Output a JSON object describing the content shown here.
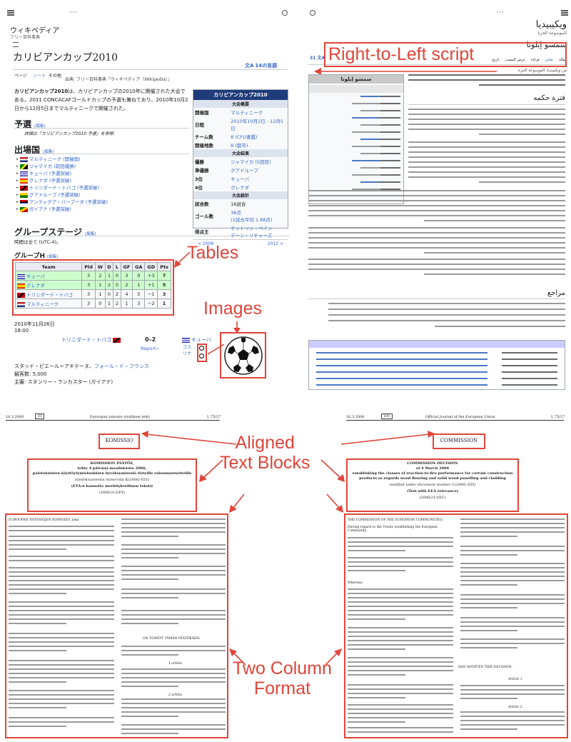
{
  "annotations": {
    "rtl": "Right-to-Left script",
    "tables": "Tables",
    "images": "Images",
    "aligned": "Aligned\nText Blocks",
    "twocol": "Two Column\nFormat"
  },
  "jp": {
    "site_name": "ウィキペディア",
    "site_tagline": "フリー百科事典",
    "title": "カリビアンカップ2010",
    "languages": "14の言語",
    "tab_page": "ページ",
    "tab_note": "ノート",
    "tab_other": "その他",
    "source": "出典: フリー百科事典『ウィキペディア（Wikipedia）』",
    "lead_bold": "カリビアンカップ2010",
    "lead": "は、カリビアンカップの2010年に開催された大会である。2011 CONCACAFゴールドカップの予選も兼ねており、2010年10月2日から12月5日までマルティニークで開催された。",
    "sec_prelim": "予選",
    "prelim_note": "詳細は「カリビアンカップ2010 予選」を参照",
    "sec_teams": "出場国",
    "teams": [
      "マルティニーク (開催国)",
      "ジャマイカ (前回優勝)",
      "キューバ (予選突破)",
      "グレナダ (予選突破)",
      "トリニダード・トバゴ (予選突破)",
      "グアドループ (予選突破)",
      "アンティグア・バーブーダ (予選突破)",
      "ガイアナ (予選突破)"
    ],
    "sec_group": "グループステージ",
    "tz_text": "時間は全て (UTC-4)。",
    "group_h": "グループH",
    "edit": "[編集]",
    "table_headers": [
      "Team",
      "Pld",
      "W",
      "D",
      "L",
      "GF",
      "GA",
      "GD",
      "Pts"
    ],
    "table_rows": [
      [
        "キューバ",
        "3",
        "2",
        "1",
        "0",
        "3",
        "0",
        "+3",
        "7"
      ],
      [
        "グレナダ",
        "3",
        "1",
        "2",
        "0",
        "2",
        "1",
        "+1",
        "5"
      ],
      [
        "トリニダード・トバゴ",
        "3",
        "1",
        "0",
        "2",
        "4",
        "5",
        "−1",
        "3"
      ],
      [
        "マルティニーク",
        "3",
        "0",
        "1",
        "2",
        "1",
        "3",
        "−2",
        "1"
      ]
    ],
    "match_date": "2010年11月26日",
    "match_time": "18:00",
    "match_home": "トリニダード・トバゴ",
    "match_score": "0–2",
    "match_away": "キューバ",
    "report": "Report",
    "scorer1": "コス",
    "scorer2": "リナ",
    "stadium_label": "スタッド・ピエール＝アキテーヌ、",
    "stadium_link": "フォール・ド・フランス",
    "attendance": "観客数: 5,000",
    "referee": "主審: スタンリー・ランカスター (ガイアナ)",
    "infobox": {
      "title": "カリビアンカップ2010",
      "sec1": "大会概要",
      "rows1": [
        [
          "開催国",
          "マルティニーク"
        ],
        [
          "日程",
          "2010年10月2日 - 12月5日"
        ],
        [
          "チーム数",
          "8 (CFU連盟)"
        ],
        [
          "開催地数",
          "8 (都市)"
        ]
      ],
      "sec2": "大会結果",
      "rows2": [
        [
          "優勝",
          "ジャマイカ (5回目)"
        ],
        [
          "準優勝",
          "グアドループ"
        ],
        [
          "3位",
          "キューバ"
        ],
        [
          "4位",
          "グレナダ"
        ]
      ],
      "sec3": "大会統計",
      "rows3": [
        [
          "試合数",
          "16試合"
        ],
        [
          "ゴール数",
          "36点\n(1試合平均 1.88点)"
        ],
        [
          "得点王",
          "ケットソン・ベイン\nデーン・リチャーズ"
        ]
      ],
      "prev": "< 2008",
      "next": "2012 >"
    }
  },
  "ar": {
    "site_name": "ويكيبيديا",
    "site_tagline": "الموسوعة الحرة",
    "title": "سمسو إيلونا",
    "tabs": [
      "مقالة",
      "نقاش",
      "قراءة",
      "عرض المصدر",
      "تاريخ"
    ],
    "source": "من ويكيبيديا، الموسوعة الحرة",
    "lang_count": "31",
    "infobox_title": "سمسو إيلونا",
    "sec_header": "فترة حكمه",
    "refs_header": "مراجع"
  },
  "fi": {
    "date": "16.3.2006",
    "page_label": "FI",
    "journal": "Euroopan unionin virallinen lehti",
    "page_ref": "L 75/27",
    "org": "KOMISSIO",
    "decision_label": "KOMISSION PÄÄTÖS,",
    "decision_date": "tehty 4 päivänä maaliskuuta 2006,",
    "decision_subject": "paloteknisten käyttäytymisluokkien hyväksymisestä tietyille rakennustuotteille",
    "notified": "(tiedoksiannettu numerolla K(2006) 655)",
    "eea": "(ETA:n kannalta merkityksellinen teksti)",
    "ref": "(2006/213/EY)",
    "col_lead": "EUROOPAN YHTEISÖJEN KOMISSIO, joka",
    "adopted": "ON TEHNYT TÄMÄN PÄÄTÖKSEN:",
    "article1": "1 artikla",
    "article2": "2 artikla"
  },
  "en": {
    "date": "16.3.2006",
    "page_label": "EN",
    "journal": "Official Journal of the European Union",
    "page_ref": "L 75/27",
    "org": "COMMISSION",
    "decision_label": "COMMISSION DECISION",
    "decision_date": "of 4 March 2006",
    "decision_subject": "establishing the classes of reaction-to-fire performance for certain construction products as regards wood flooring and solid wood panelling and cladding",
    "notified": "(notified under document number C(2006) 655)",
    "eea": "(Text with EEA relevance)",
    "ref": "(2006/213/EC)",
    "col_lead": "THE COMMISSION OF THE EUROPEAN COMMUNITIES,",
    "having_regard": "Having regard to the Treaty establishing the European Community,",
    "whereas": "Whereas:",
    "adopted": "HAS ADOPTED THIS DECISION:",
    "article1": "Article 1",
    "article2": "Article 2"
  },
  "icons": [
    "hamburger-icon",
    "more-icon",
    "search-icon",
    "soccer-ball-icon",
    "pencil-icon",
    "flag-icon"
  ],
  "colors": {
    "annotation": "#e0453a",
    "link": "#3366cc",
    "infobox_header": "#1f3b7a",
    "table_border": "#9a9a9a"
  }
}
